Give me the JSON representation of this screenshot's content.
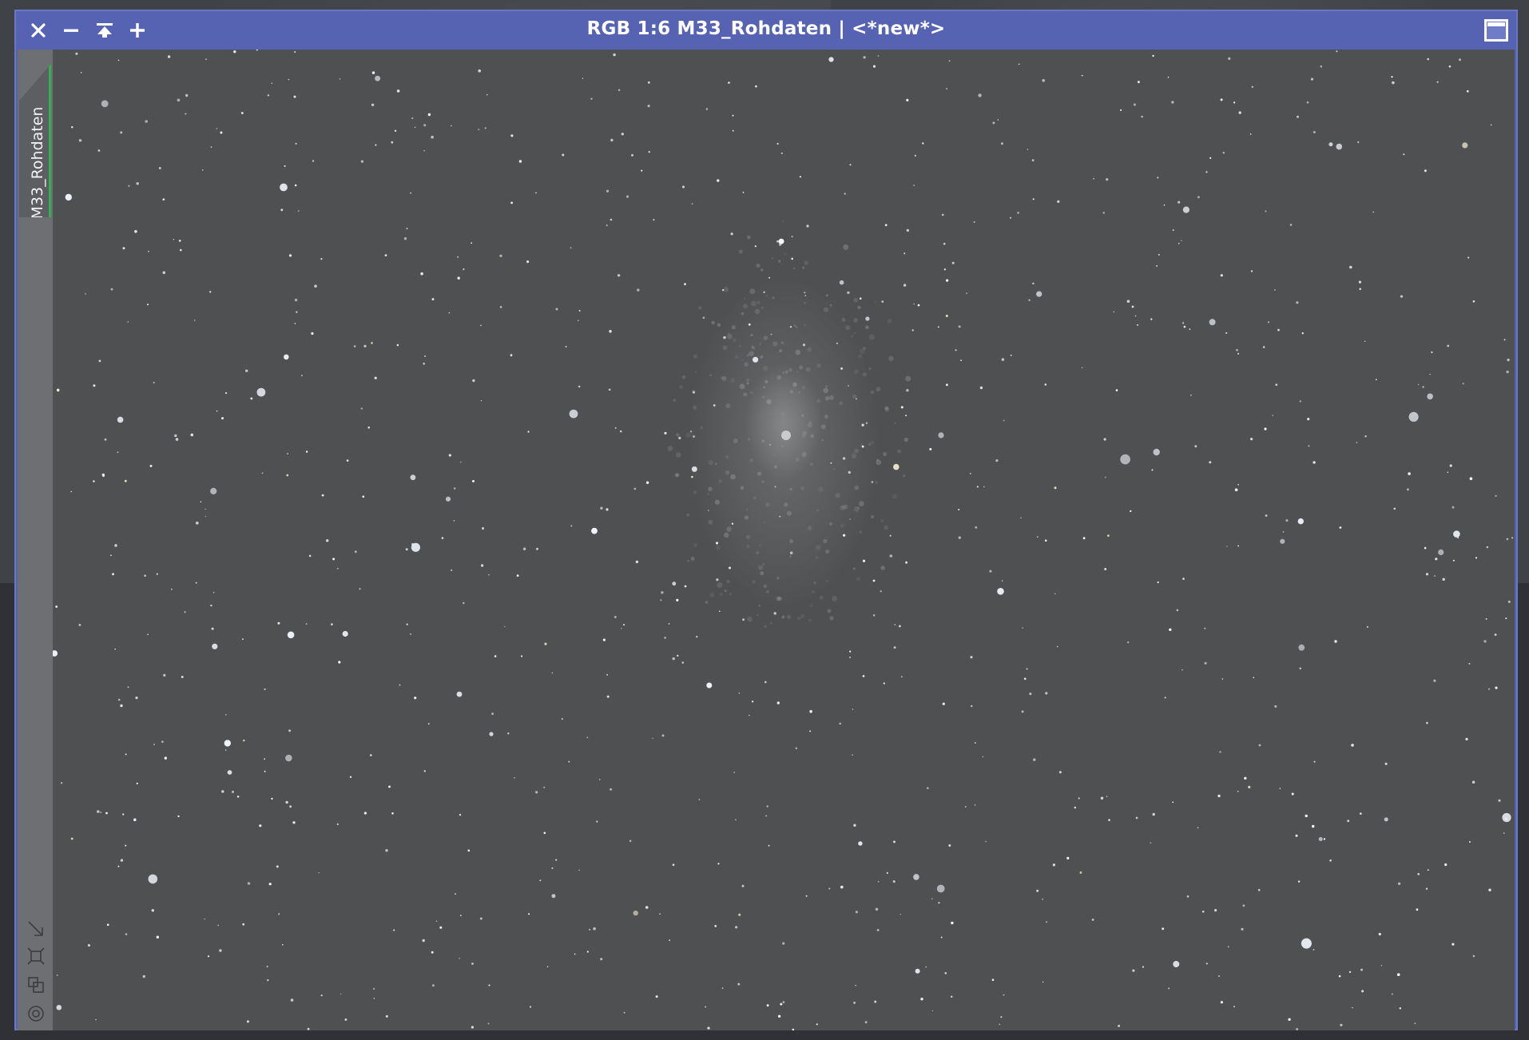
{
  "window": {
    "title": "RGB 1:6 M33_Rohdaten | <*new*>",
    "view_tab_label": "M33_Rohdaten",
    "accent_color": "#5663b3",
    "tab_indicator_color": "#2fb34e",
    "controls": [
      "close-icon",
      "minimize-icon",
      "shade-icon",
      "maximize-plus-icon",
      "maximize-window-icon"
    ],
    "side_tools": [
      "fit-view-icon",
      "zoom-to-optimal-icon",
      "clone-view-icon",
      "target-icon"
    ]
  }
}
